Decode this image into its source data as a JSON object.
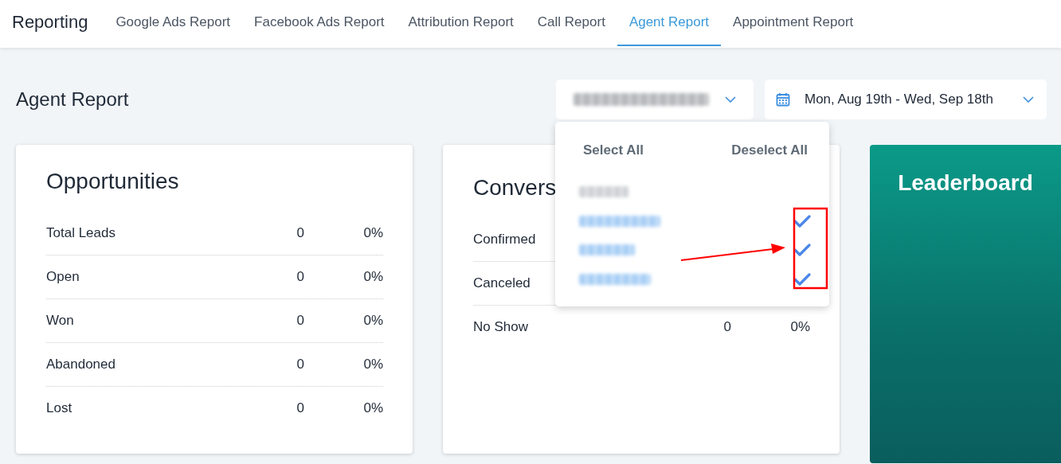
{
  "header": {
    "title": "Reporting",
    "tabs": [
      {
        "label": "Google Ads Report",
        "selected": false
      },
      {
        "label": "Facebook Ads Report",
        "selected": false
      },
      {
        "label": "Attribution Report",
        "selected": false
      },
      {
        "label": "Call Report",
        "selected": false
      },
      {
        "label": "Agent Report",
        "selected": true
      },
      {
        "label": "Appointment Report",
        "selected": false
      }
    ]
  },
  "page_title": "Agent Report",
  "agent_filter": {
    "expanded": true
  },
  "date_filter": {
    "value": "Mon, Aug 19th - Wed, Sep 18th"
  },
  "agent_menu": {
    "actions": [
      "Select All",
      "Deselect All"
    ],
    "agents": [
      {
        "selected": false
      },
      {
        "selected": true
      },
      {
        "selected": true
      },
      {
        "selected": true
      }
    ]
  },
  "cards": [
    {
      "title": "Opportunities",
      "rows": [
        {
          "label": "Total Leads",
          "count": "0",
          "percent": "0%"
        },
        {
          "label": "Open",
          "count": "0",
          "percent": "0%"
        },
        {
          "label": "Won",
          "count": "0",
          "percent": "0%"
        },
        {
          "label": "Abandoned",
          "count": "0",
          "percent": "0%"
        },
        {
          "label": "Lost",
          "count": "0",
          "percent": "0%"
        }
      ]
    },
    {
      "title": "Convers",
      "rows": [
        {
          "label": "Confirmed"
        },
        {
          "label": "Canceled"
        },
        {
          "label": "No Show",
          "count": "0",
          "percent": "0%"
        }
      ]
    }
  ],
  "leaderboard": {
    "title": "Leaderboard"
  }
}
